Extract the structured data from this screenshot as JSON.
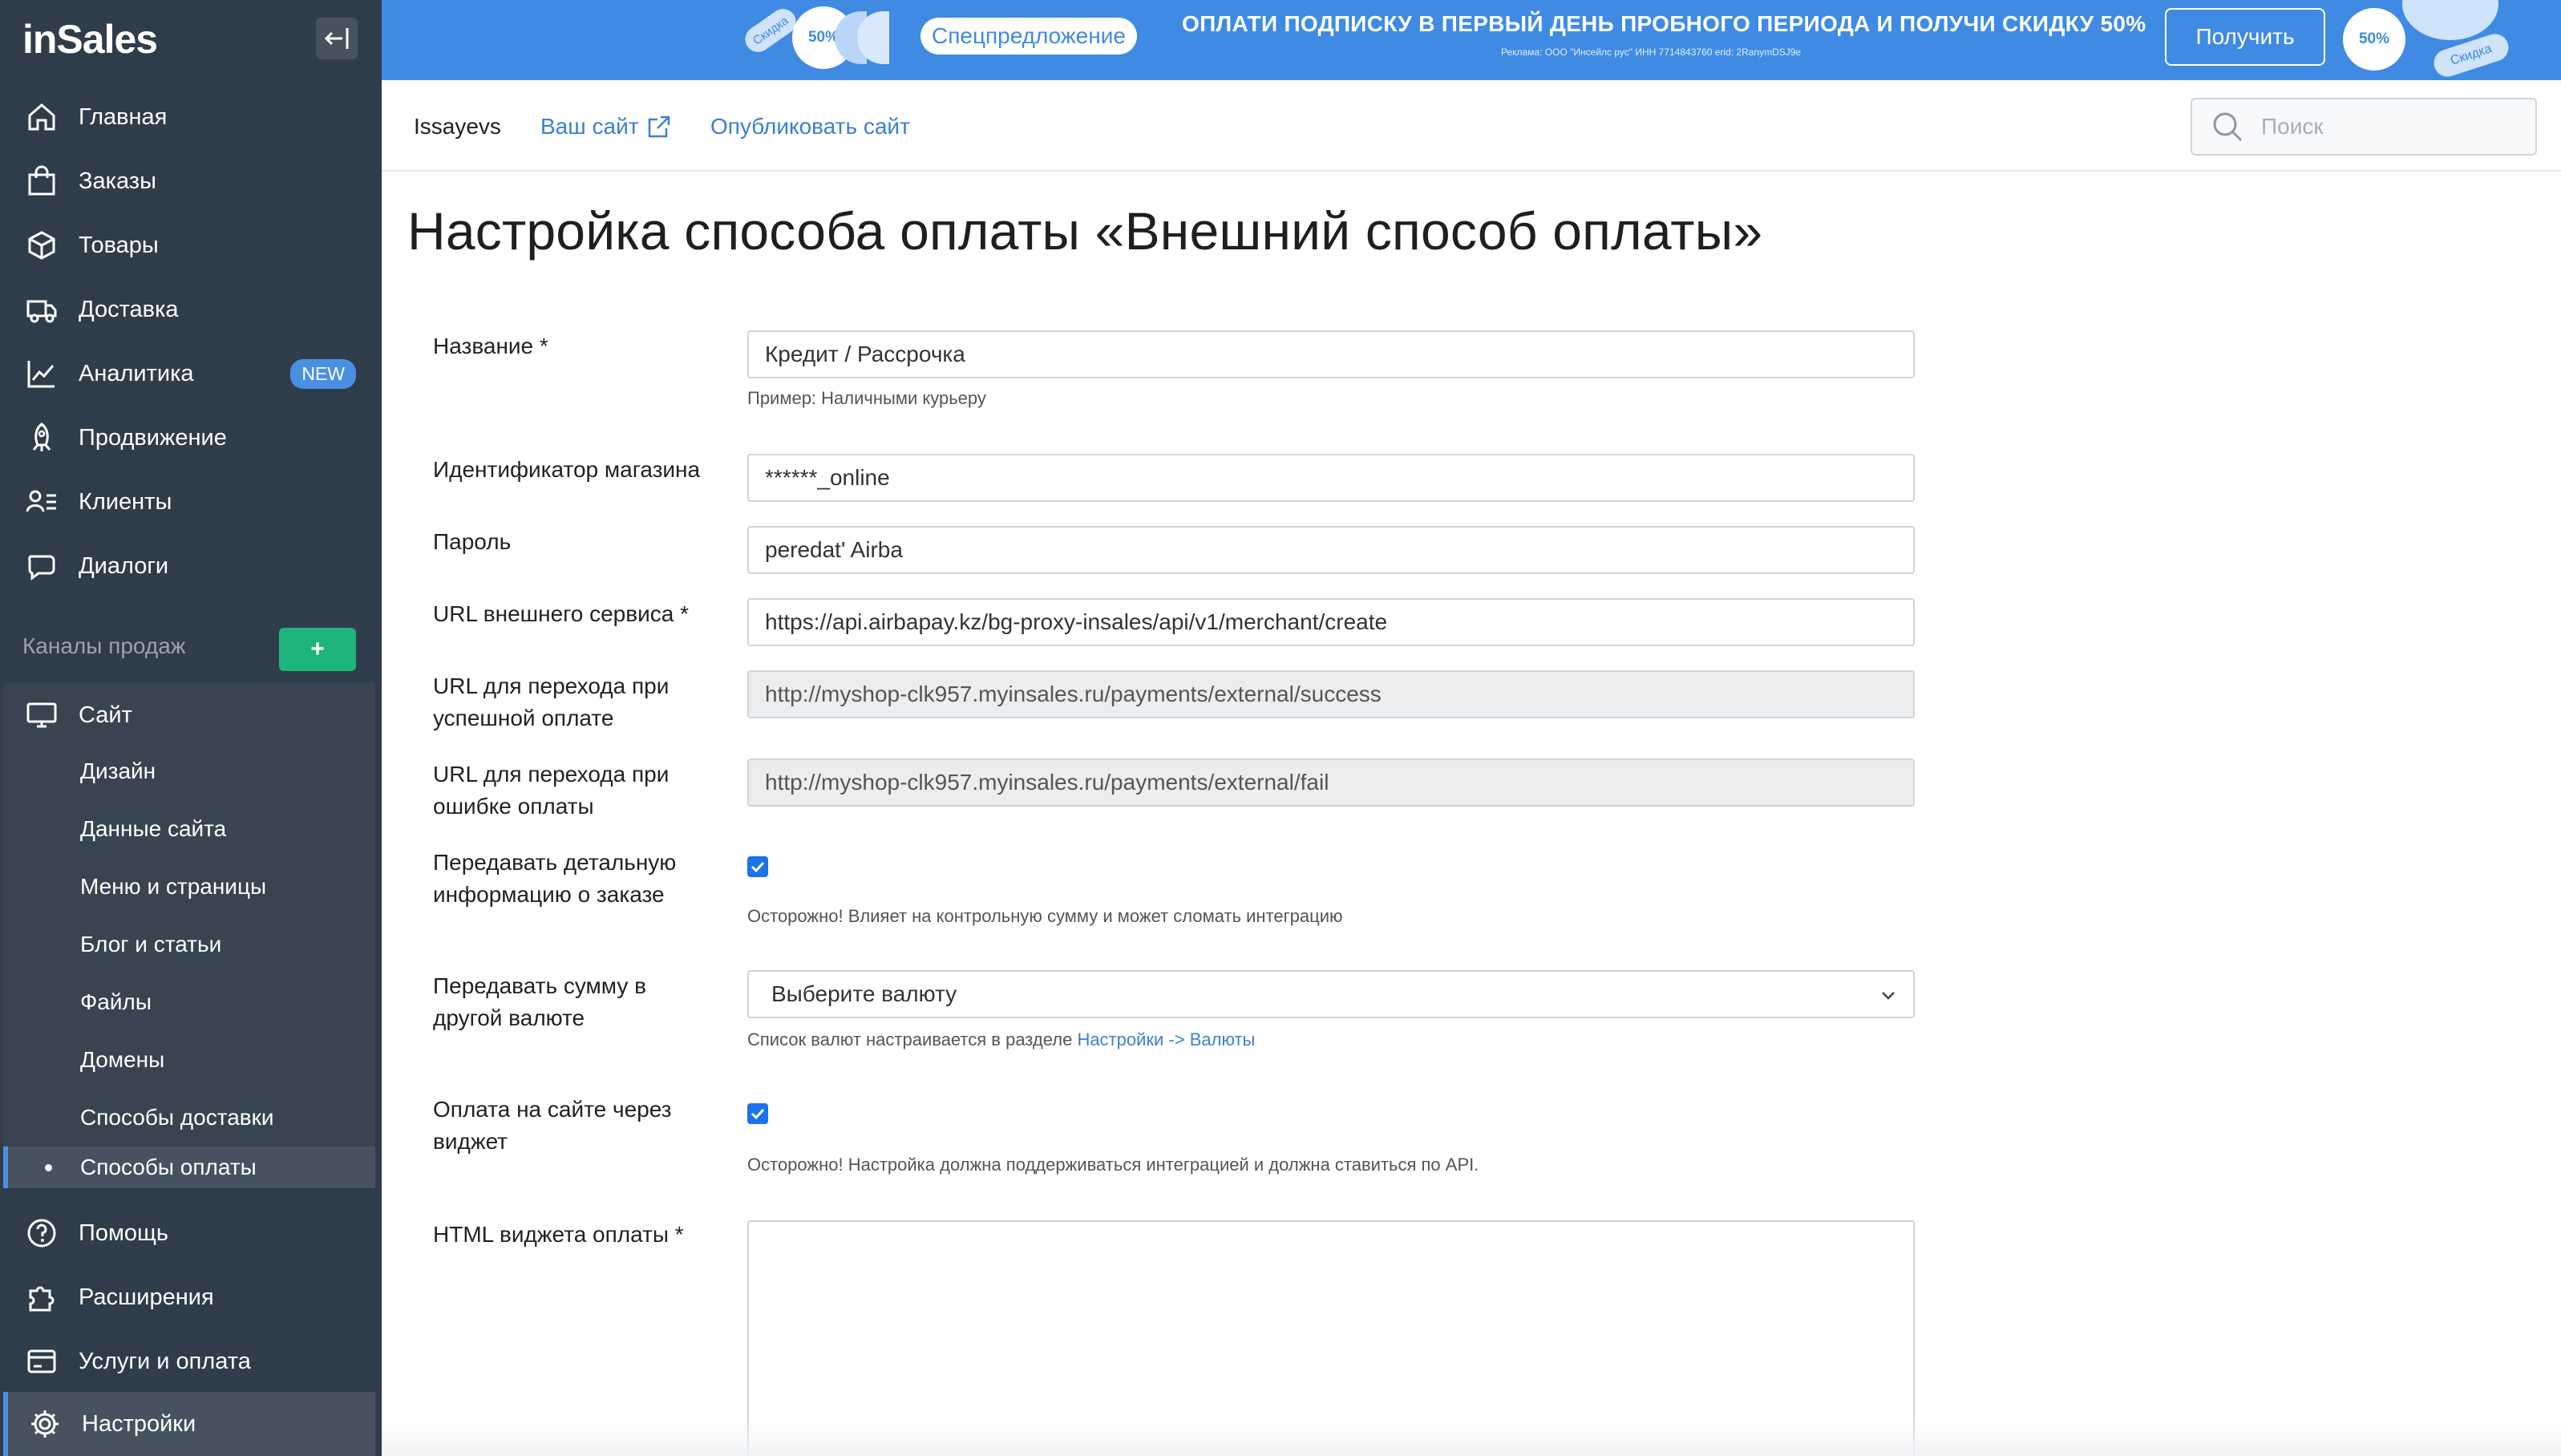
{
  "sidebar": {
    "logo": "inSales",
    "items": [
      {
        "label": "Главная",
        "icon": "home-icon"
      },
      {
        "label": "Заказы",
        "icon": "orders-bag-icon"
      },
      {
        "label": "Товары",
        "icon": "box-icon"
      },
      {
        "label": "Доставка",
        "icon": "truck-icon"
      },
      {
        "label": "Аналитика",
        "icon": "analytics-chart-icon",
        "badge": "NEW"
      },
      {
        "label": "Продвижение",
        "icon": "rocket-icon"
      },
      {
        "label": "Клиенты",
        "icon": "clients-icon"
      },
      {
        "label": "Диалоги",
        "icon": "chat-icon"
      }
    ],
    "channels_title": "Каналы продаж",
    "add_channel": "+",
    "site": {
      "label": "Сайт",
      "subitems": [
        "Дизайн",
        "Данные сайта",
        "Меню и страницы",
        "Блог и статьи",
        "Файлы",
        "Домены",
        "Способы доставки",
        "Способы оплаты"
      ],
      "active_subitem": "Способы оплаты"
    },
    "bottom_items": [
      {
        "label": "Помощь",
        "icon": "help-icon"
      },
      {
        "label": "Расширения",
        "icon": "puzzle-icon"
      },
      {
        "label": "Услуги и оплата",
        "icon": "billing-icon"
      },
      {
        "label": "Настройки",
        "icon": "gear-icon"
      }
    ]
  },
  "promo": {
    "tag_left": "Скидка",
    "flower_left": "50%",
    "special": "Спецпредложение",
    "headline": "ОПЛАТИ ПОДПИСКУ В ПЕРВЫЙ ДЕНЬ ПРОБНОГО ПЕРИОДА И ПОЛУЧИ СКИДКУ 50%",
    "fine_print": "Реклама: ООО \"Инсейлс рус\" ИНН 7714843760 erid: 2RanymDSJ9e",
    "button": "Получить",
    "flower_right": "50%",
    "tag_right": "Скидка",
    "color": "#3f8be4"
  },
  "topbar": {
    "shop_name": "Issayevs",
    "your_site": "Ваш сайт",
    "publish": "Опубликовать сайт",
    "search_placeholder": "Поиск"
  },
  "page": {
    "title": "Настройка способа оплаты «Внешний способ оплаты»"
  },
  "form": {
    "name": {
      "label": "Название *",
      "value": "Кредит / Рассрочка",
      "hint": "Пример: Наличными курьеру"
    },
    "shop_id": {
      "label": "Идентификатор магазина",
      "value": "******_online"
    },
    "password": {
      "label": "Пароль",
      "value": "peredat' Airba"
    },
    "external_url": {
      "label": "URL внешнего сервиса *",
      "value": "https://api.airbapay.kz/bg-proxy-insales/api/v1/merchant/create"
    },
    "success_url": {
      "label": "URL для перехода при успешной оплате",
      "value": "http://myshop-clk957.myinsales.ru/payments/external/success"
    },
    "fail_url": {
      "label": "URL для перехода при ошибке оплаты",
      "value": "http://myshop-clk957.myinsales.ru/payments/external/fail"
    },
    "detail_info": {
      "label": "Передавать детальную информацию о заказе",
      "checked": true,
      "hint": "Осторожно! Влияет на контрольную сумму и может сломать интеграцию"
    },
    "currency": {
      "label": "Передавать сумму в другой валюте",
      "value": "Выберите валюту",
      "hint_prefix": "Список валют настраивается в разделе ",
      "hint_link": "Настройки -> Валюты"
    },
    "widget": {
      "label": "Оплата на сайте через виджет",
      "checked": true,
      "hint": "Осторожно! Настройка должна поддерживаться интеграцией и должна ставиться по API."
    },
    "widget_html": {
      "label": "HTML виджета оплаты *",
      "value": ""
    }
  }
}
